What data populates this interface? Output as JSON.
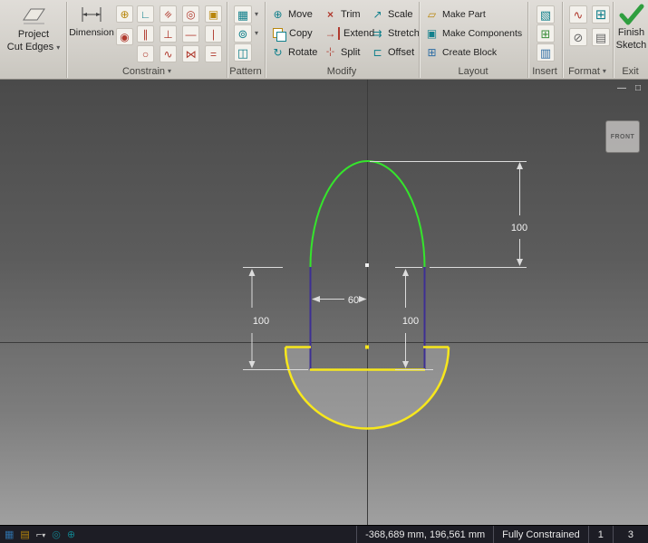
{
  "ribbon": {
    "project": {
      "line1": "Project",
      "line2": "Cut Edges"
    },
    "dimension_label": "Dimension",
    "panel_labels": {
      "constrain": "Constrain",
      "pattern": "Pattern",
      "modify": "Modify",
      "layout": "Layout",
      "insert": "Insert",
      "format": "Format",
      "exit": "Exit"
    },
    "modify_buttons": {
      "move": "Move",
      "copy": "Copy",
      "rotate": "Rotate",
      "trim": "Trim",
      "extend": "Extend",
      "split": "Split",
      "scale": "Scale",
      "stretch": "Stretch",
      "offset": "Offset"
    },
    "layout_buttons": {
      "make_part": "Make Part",
      "make_components": "Make Components",
      "create_block": "Create Block"
    },
    "finish": {
      "line1": "Finish",
      "line2": "Sketch"
    }
  },
  "icons": {
    "dropdown": "▾",
    "coincident": "∟",
    "collinear": "≡",
    "concentric": "◎",
    "fix": "▣",
    "parallel": "∥",
    "perpendicular": "⊥",
    "horizontal": "—",
    "vertical": "∣",
    "tangent": "○",
    "smooth": "∿",
    "symmetric": "⋈",
    "equal": "=",
    "auto_dimension": "⊕",
    "show_constraints": "◉",
    "rect_pattern": "▦",
    "circ_pattern": "⊚",
    "mirror": "◫",
    "move": "⊕",
    "rotate": "↻",
    "trim": "×",
    "extend": "→",
    "split": "-¦-",
    "scale": "↗",
    "stretch": "⇉",
    "offset": "⊏",
    "make_part": "▱",
    "make_components": "▣",
    "create_block": "⊞",
    "insert_image": "▧",
    "import_points": "⊞",
    "acad": "▥",
    "construction": "∿",
    "centerline": "⊞",
    "center_point": "⊘",
    "driven_dim": "▤",
    "minimize": "—",
    "restore": "□",
    "sb_snap": "▦",
    "sb_grid": "▤",
    "sb_filter": "⌐",
    "sb_measure": "◎",
    "sb_pan": "⊕"
  },
  "dims": {
    "right": "100",
    "left": "100",
    "mid": "100",
    "width": "60"
  },
  "viewcube": {
    "face": "FRONT"
  },
  "statusbar": {
    "coords": "-368,689 mm, 196,561 mm",
    "status": "Fully Constrained",
    "field_a": "1",
    "field_b": "3"
  },
  "colors": {
    "sketch_green": "#35e52c",
    "sketch_yellow": "#f7e71c",
    "sketch_purple": "#3d2f94",
    "dimension_white": "#e8e8e8"
  }
}
